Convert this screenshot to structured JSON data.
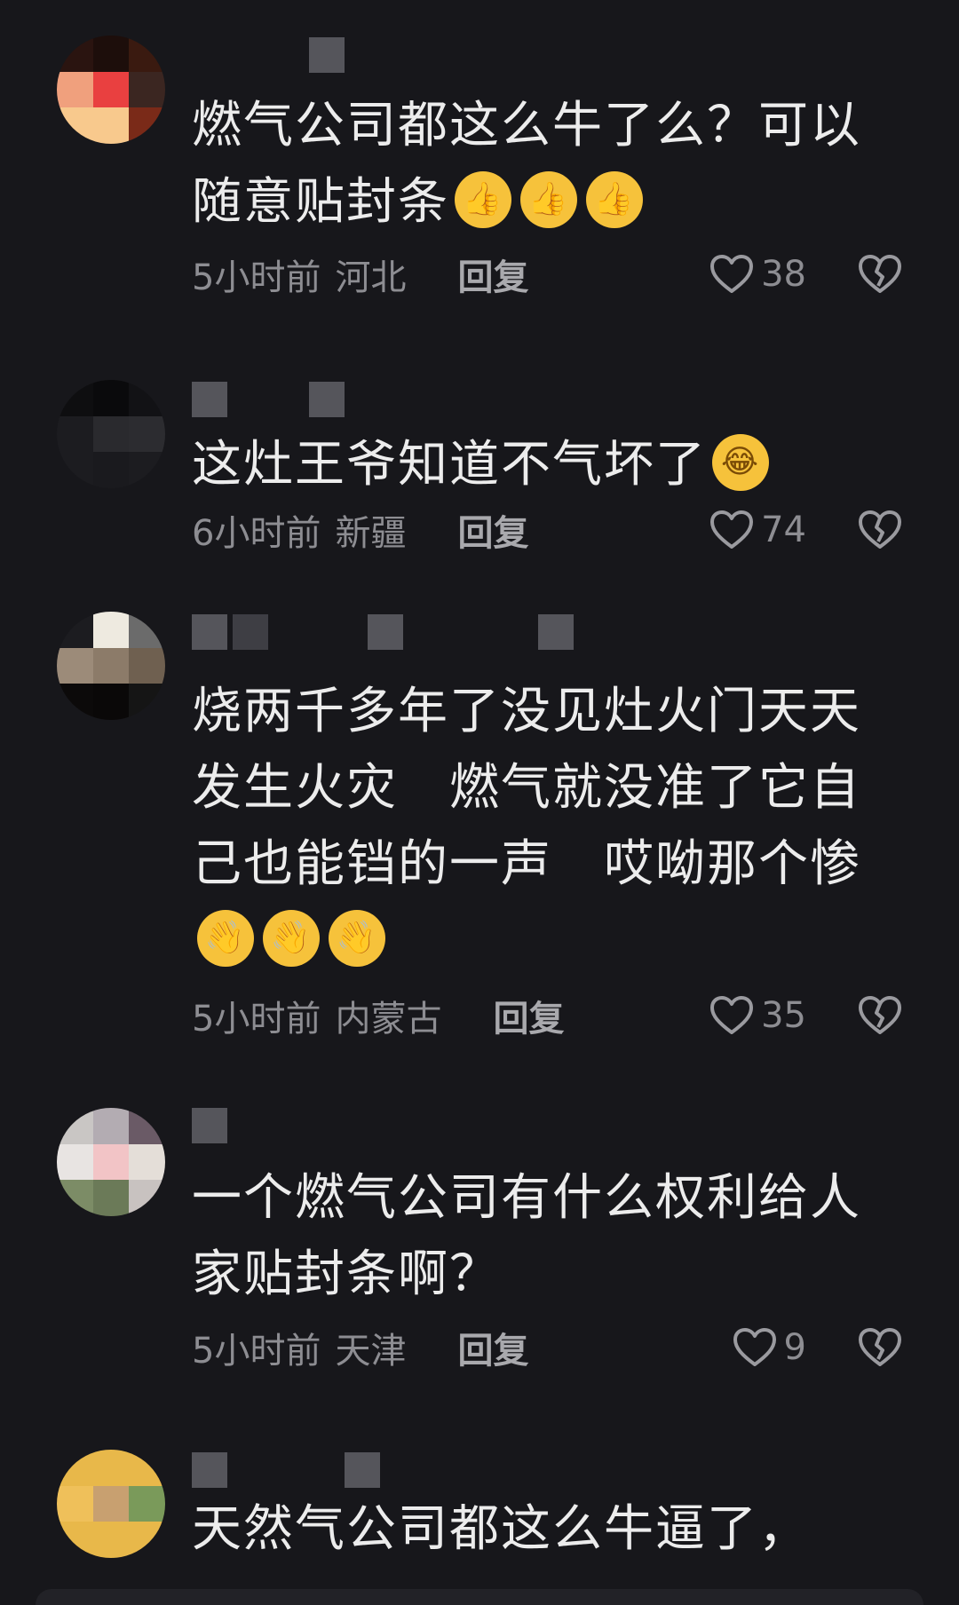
{
  "comments": [
    {
      "text": "燃气公司都这么牛了么？可以随意贴封条",
      "emojis": [
        "thumbs-up",
        "thumbs-up",
        "thumbs-up"
      ],
      "time": "5小时前",
      "location": "河北",
      "reply_label": "回复",
      "likes": "38"
    },
    {
      "text": "这灶王爷知道不气坏了",
      "emojis": [
        "laughing-crying"
      ],
      "time": "6小时前",
      "location": "新疆",
      "reply_label": "回复",
      "likes": "74"
    },
    {
      "text": "烧两千多年了没见灶火门天天发生火灾　燃气就没准了它自己也能铛的一声　哎呦那个惨",
      "emojis": [
        "waving-hand",
        "waving-hand",
        "waving-hand"
      ],
      "time": "5小时前",
      "location": "内蒙古",
      "reply_label": "回复",
      "likes": "35"
    },
    {
      "text": "一个燃气公司有什么权利给人家贴封条啊？",
      "emojis": [],
      "time": "5小时前",
      "location": "天津",
      "reply_label": "回复",
      "likes": "9"
    },
    {
      "text": "天然气公司都这么牛逼了，",
      "emojis": [],
      "time": "",
      "location": "",
      "reply_label": "",
      "likes": ""
    }
  ],
  "icons": {
    "like": "heart-outline-icon",
    "dislike": "broken-heart-icon"
  },
  "colors": {
    "background": "#17171b",
    "text": "#ececec",
    "meta": "#8d8d92"
  }
}
